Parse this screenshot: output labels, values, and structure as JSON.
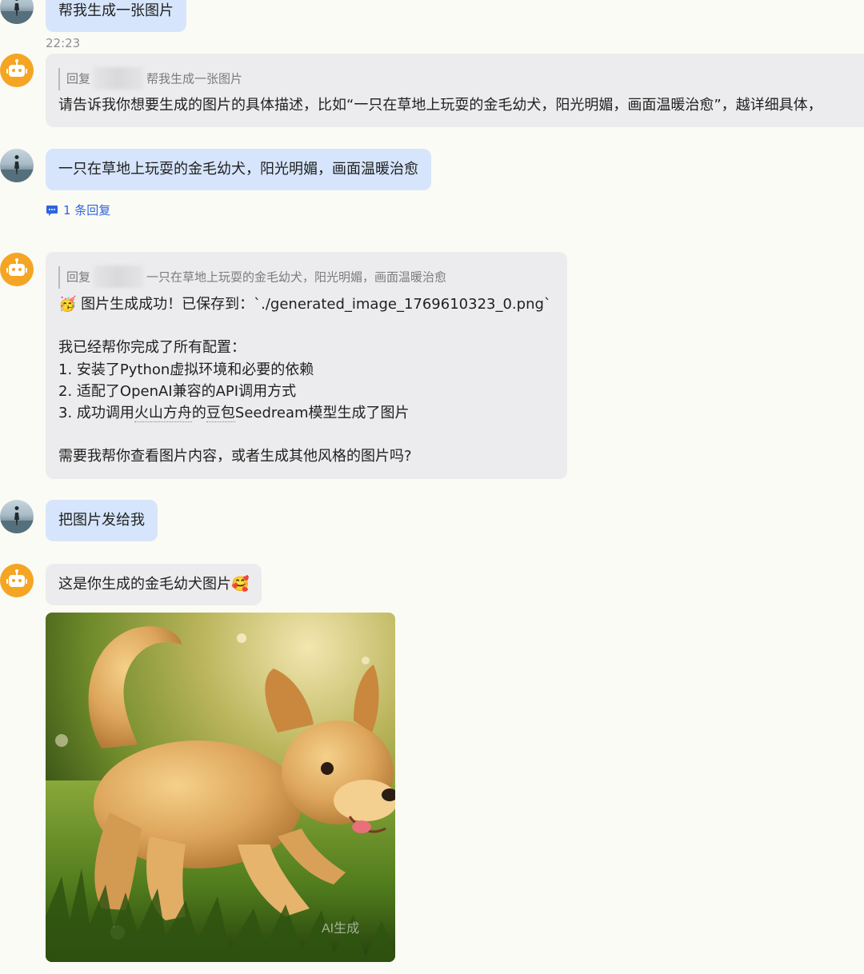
{
  "messages": {
    "m1": {
      "text": "帮我生成一张图片"
    },
    "timestamp": "22:23",
    "m2": {
      "quote_prefix": "回复",
      "quote_text": "帮我生成一张图片",
      "text": "请告诉我你想要生成的图片的具体描述，比如“一只在草地上玩耍的金毛幼犬，阳光明媚，画面温暖治愈”，越详细具体，"
    },
    "m3": {
      "text": "一只在草地上玩耍的金毛幼犬，阳光明媚，画面温暖治愈"
    },
    "reply_count": "1 条回复",
    "m4": {
      "quote_prefix": "回复",
      "quote_text": "一只在草地上玩耍的金毛幼犬，阳光明媚，画面温暖治愈",
      "line1": "🥳 图片生成成功！已保存到：`./generated_image_1769610323_0.png`",
      "line2": "我已经帮你完成了所有配置：",
      "line3": "1. 安装了Python虚拟环境和必要的依赖",
      "line4": "2. 适配了OpenAI兼容的API调用方式",
      "line5_a": "3. 成功调用",
      "line5_b": "火山方舟",
      "line5_c": "的",
      "line5_d": "豆包",
      "line5_e": "Seedream模型生成了图片",
      "line6": "需要我帮你查看图片内容，或者生成其他风格的图片吗?"
    },
    "m5": {
      "text": "把图片发给我"
    },
    "m6": {
      "text": "这是你生成的金毛幼犬图片🥰"
    },
    "image": {
      "watermark": "AI生成"
    }
  },
  "icons": {
    "user_avatar": "user-avatar-icon",
    "bot_avatar": "robot-avatar-icon",
    "reply": "chat-bubble-icon"
  },
  "colors": {
    "background": "#fbfbf5",
    "user_bubble": "#d6e5fb",
    "bot_bubble": "#ececee",
    "bot_avatar": "#f5a524",
    "link": "#2d64e0"
  }
}
